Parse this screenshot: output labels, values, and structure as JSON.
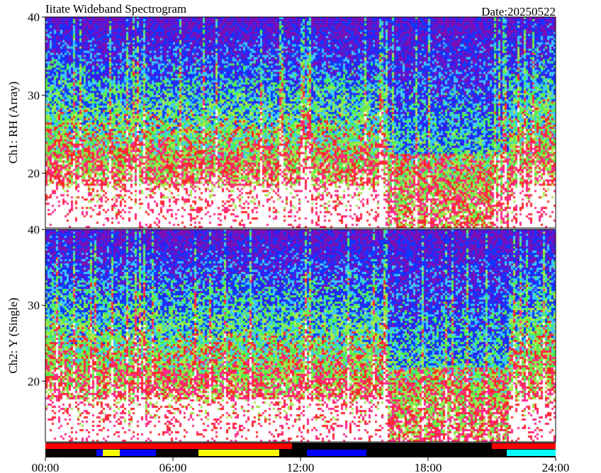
{
  "header": {
    "title": "Iitate Wideband Spectrogram",
    "date": "Date:20250522"
  },
  "colors": {
    "palette": [
      "#7a10b4",
      "#3a1cf0",
      "#0a3cff",
      "#3cc8ff",
      "#50f050",
      "#a8e84c",
      "#ff2a2a",
      "#ff2a8c",
      "#ffffff"
    ],
    "status_bar_background": "#000000"
  },
  "chart_data": {
    "type": "heatmap",
    "x_axis": {
      "range_hours": [
        0,
        24
      ],
      "ticks": [
        0,
        6,
        12,
        18,
        24
      ],
      "tick_labels": [
        "00:00",
        "06:00",
        "12:00",
        "18:00",
        "24:00"
      ]
    },
    "panels": [
      {
        "ylabel": "Ch1: RH (Array)",
        "ylim": [
          13,
          40
        ],
        "yticks": [
          20,
          30,
          40
        ],
        "ytick_labels": [
          "20",
          "30",
          "40"
        ],
        "quiet_window_hours": [
          16.0,
          21.8
        ]
      },
      {
        "ylabel": "Ch2: Y (Single)",
        "ylim": [
          12,
          40
        ],
        "yticks": [
          20,
          30,
          40
        ],
        "ytick_labels": [
          "20",
          "30",
          "40"
        ],
        "quiet_window_hours": [
          16.0,
          21.8
        ]
      }
    ],
    "status_bars": [
      {
        "row": 1,
        "segments": [
          {
            "start": 0.0,
            "end": 11.6,
            "color": "#ff0000"
          },
          {
            "start": 21.0,
            "end": 24.0,
            "color": "#ff0000"
          }
        ]
      },
      {
        "row": 2,
        "segments": [
          {
            "start": 2.4,
            "end": 2.7,
            "color": "#0000ff"
          },
          {
            "start": 2.7,
            "end": 3.5,
            "color": "#ffff00"
          },
          {
            "start": 3.5,
            "end": 5.2,
            "color": "#0000ff"
          },
          {
            "start": 7.2,
            "end": 11.0,
            "color": "#ffff00"
          },
          {
            "start": 12.3,
            "end": 15.1,
            "color": "#0000ff"
          },
          {
            "start": 21.7,
            "end": 24.0,
            "color": "#00ffff"
          }
        ]
      }
    ]
  }
}
